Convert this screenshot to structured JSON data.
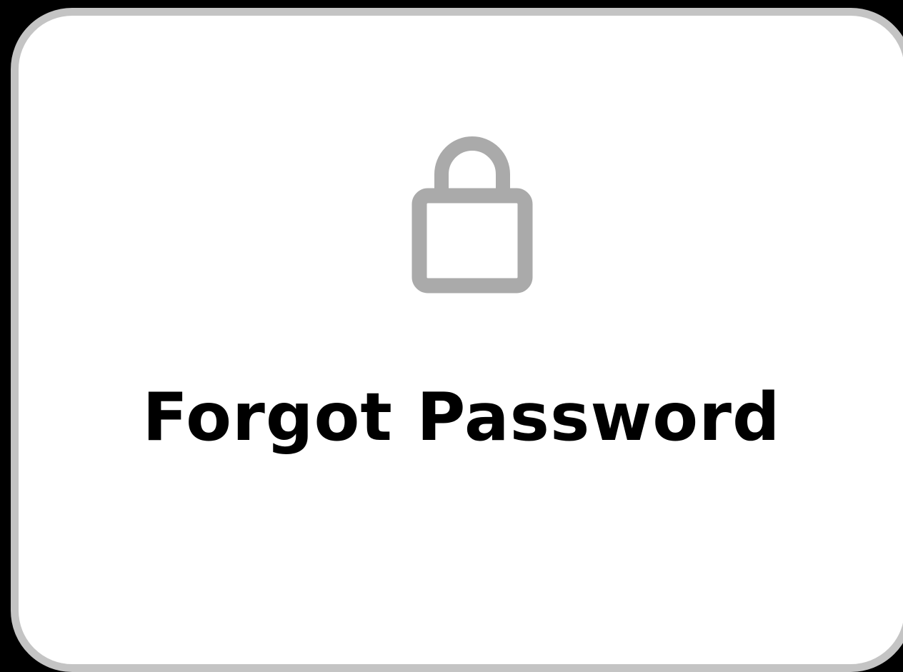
{
  "card": {
    "icon": "lock-icon",
    "title": "Forgot Password"
  },
  "colors": {
    "background": "#000000",
    "card": "#ffffff",
    "card_border": "#c4c4c4",
    "icon": "#aaaaaa",
    "title": "#000000"
  }
}
